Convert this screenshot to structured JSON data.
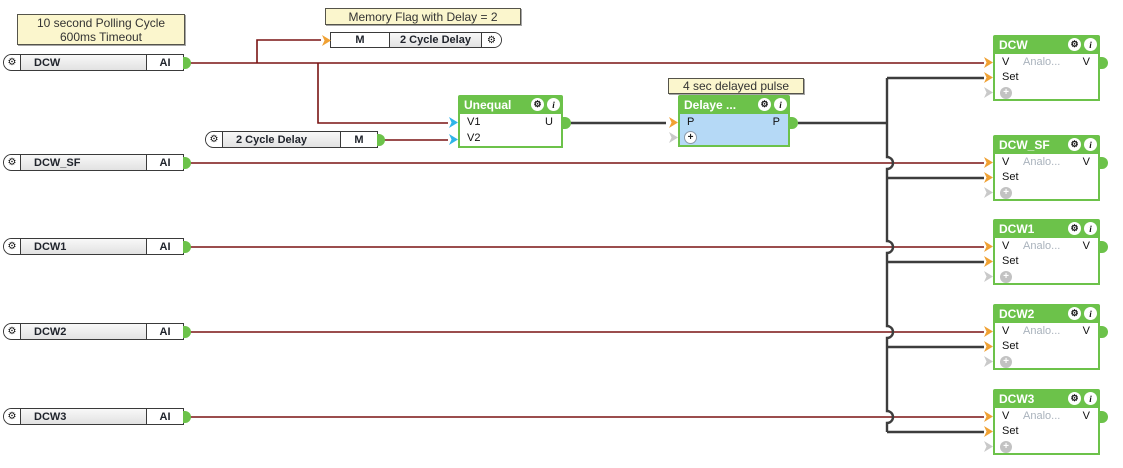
{
  "colors": {
    "wire_analog": "#7a1413",
    "wire_digital": "#3d3d3d",
    "block_green": "#6cc24a",
    "selected_body": "#b5d9f6",
    "connector_orange": "#f0a133",
    "connector_cyan": "#2fb4e9",
    "connector_unused": "#c9c9c9",
    "note_background": "#fbf6cd"
  },
  "icons": {
    "gear": "⚙",
    "info": "i",
    "plus": "+"
  },
  "notes": {
    "polling": {
      "line1": "10 second Polling Cycle",
      "line2": "600ms Timeout"
    },
    "memory": {
      "text": "Memory Flag with Delay = 2"
    },
    "pulse": {
      "text": "4 sec delayed pulse"
    }
  },
  "inputs": [
    {
      "label": "DCW",
      "port": "AI"
    },
    {
      "label": "DCW_SF",
      "port": "AI"
    },
    {
      "label": "DCW1",
      "port": "AI"
    },
    {
      "label": "DCW2",
      "port": "AI"
    },
    {
      "label": "DCW3",
      "port": "AI"
    }
  ],
  "memory_write": {
    "port": "M",
    "label": "2 Cycle Delay"
  },
  "memory_read": {
    "label": "2 Cycle Delay",
    "port": "M"
  },
  "unequal": {
    "title": "Unequal",
    "input1": "V1",
    "input2": "V2",
    "output": "U"
  },
  "delay": {
    "title": "Delaye ...",
    "input": "P",
    "output": "P"
  },
  "outputs": [
    {
      "title": "DCW"
    },
    {
      "title": "DCW_SF"
    },
    {
      "title": "DCW1"
    },
    {
      "title": "DCW2"
    },
    {
      "title": "DCW3"
    }
  ],
  "output_rows": {
    "v_in": "V",
    "analog": "Analo...",
    "v_out": "V",
    "set": "Set"
  }
}
